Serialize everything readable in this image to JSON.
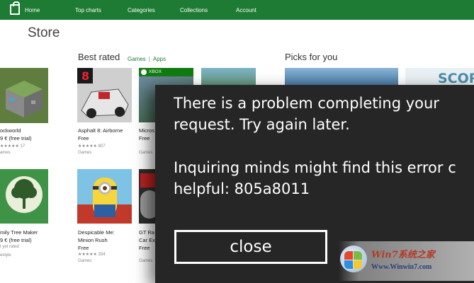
{
  "nav": {
    "items": [
      "Home",
      "Top charts",
      "Categories",
      "Collections",
      "Account"
    ]
  },
  "page_title": "Store",
  "best_rated": {
    "title": "Best rated",
    "filter_games": "Games",
    "filter_separator": "|",
    "filter_apps": "Apps"
  },
  "picks": {
    "title": "Picks for you"
  },
  "apps": [
    {
      "name": "ockworld",
      "price": "9 €  (free trial)",
      "meta": "ames",
      "rating": "17"
    },
    {
      "name": "Asphalt 8: Airborne",
      "price": "Free",
      "meta": "Games",
      "rating": "807"
    },
    {
      "name": "Micros",
      "price": "Free",
      "meta": "Games",
      "badge": "XBOX"
    },
    {
      "name": "mily Tree Maker",
      "price": "9 €  (free trial)",
      "meta": "estyle",
      "rating_text": "t yet rated"
    },
    {
      "name": "Despicable Me:",
      "name2": "Minion Rush",
      "price": "Free",
      "meta": "Games",
      "rating": "334"
    },
    {
      "name": "GT Ra",
      "name2": "Car Exp",
      "price": "Free",
      "meta": "Games"
    }
  ],
  "tile_texts": {
    "asphalt_number": "8",
    "picks_partial": "SCOR"
  },
  "dialog": {
    "line1": "There is a problem completing your",
    "line2": "request. Try again later.",
    "line3": "Inquiring minds might find this error c",
    "line4": "helpful: 805a8011",
    "close_label": "close"
  },
  "watermark": {
    "line1": "Win7系统之家",
    "line2": "Www.Winwin7.com"
  },
  "colors": {
    "nav_bg": "#1e7b34",
    "dialog_bg": "#262626",
    "accent": "#1e7b34"
  }
}
